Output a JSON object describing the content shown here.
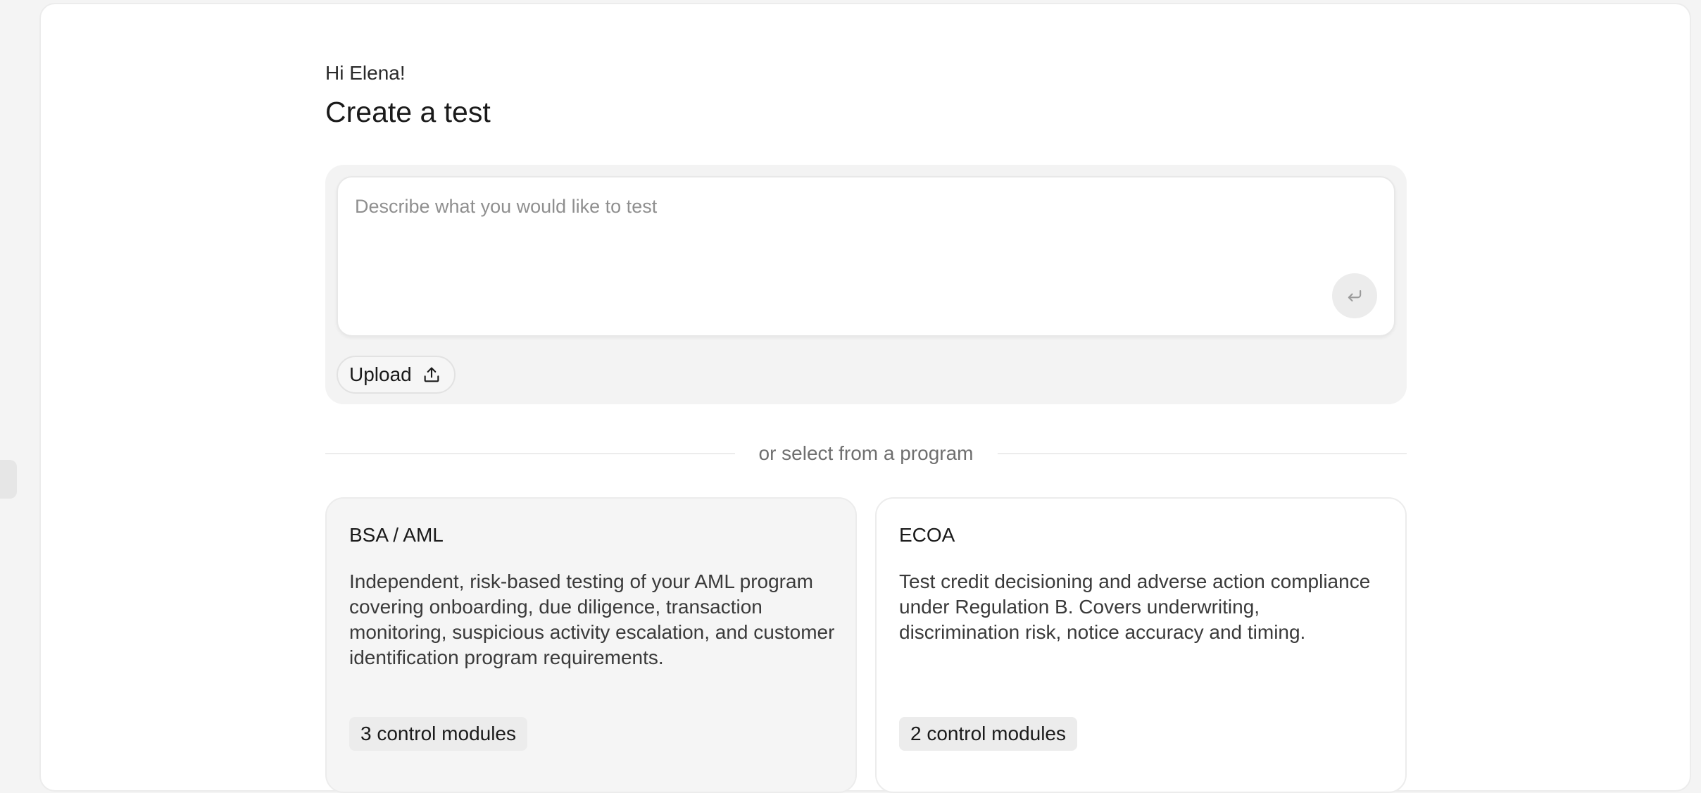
{
  "header": {
    "greeting": "Hi Elena!",
    "title": "Create a test"
  },
  "composer": {
    "placeholder": "Describe what you would like to test",
    "value": "",
    "upload_label": "Upload",
    "submit_icon": "enter-icon",
    "upload_icon": "upload-icon"
  },
  "divider": {
    "label": "or select from a program"
  },
  "programs": [
    {
      "title": "BSA / AML",
      "description": "Independent, risk-based testing of your AML program covering onboarding, due diligence, transaction monitoring, suspicious activity escalation, and customer identification program requirements.",
      "badge": "3 control modules"
    },
    {
      "title": "ECOA",
      "description": "Test credit decisioning and adverse action compliance under Regulation B. Covers underwriting, discrimination risk, notice accuracy and timing.",
      "badge": "2 control modules"
    }
  ],
  "colors": {
    "background": "#f4f4f4",
    "panel": "#ffffff",
    "composer_bg": "#f3f3f3",
    "badge_bg": "#ececec",
    "muted_text": "#6f6f6f"
  }
}
